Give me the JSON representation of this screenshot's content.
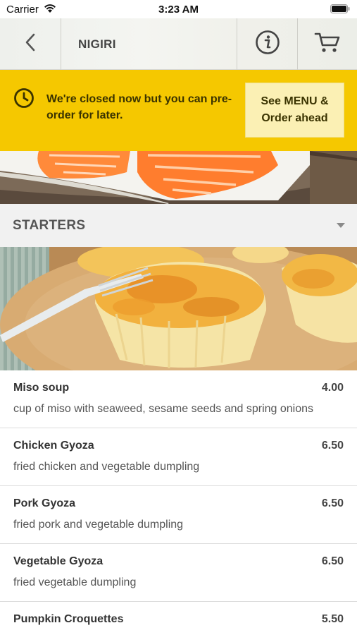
{
  "status": {
    "carrier": "Carrier",
    "time": "3:23 AM"
  },
  "nav": {
    "title": "NIGIRI",
    "back_icon": "chevron-left-icon",
    "info_icon": "info-icon",
    "cart_icon": "cart-icon"
  },
  "banner": {
    "message": "We're closed now but you can pre-order for later.",
    "button_label": "See MENU & Order ahead",
    "bg_color": "#f5c800"
  },
  "section": {
    "title": "STARTERS"
  },
  "menu_items": [
    {
      "name": "Miso soup",
      "price": "4.00",
      "description": "cup of miso with seaweed, sesame seeds and spring onions"
    },
    {
      "name": "Chicken Gyoza",
      "price": "6.50",
      "description": "fried chicken and vegetable dumpling"
    },
    {
      "name": "Pork Gyoza",
      "price": "6.50",
      "description": "fried pork and vegetable dumpling"
    },
    {
      "name": "Vegetable Gyoza",
      "price": "6.50",
      "description": "fried vegetable dumpling"
    },
    {
      "name": "Pumpkin Croquettes",
      "price": "5.50",
      "description": ""
    }
  ]
}
